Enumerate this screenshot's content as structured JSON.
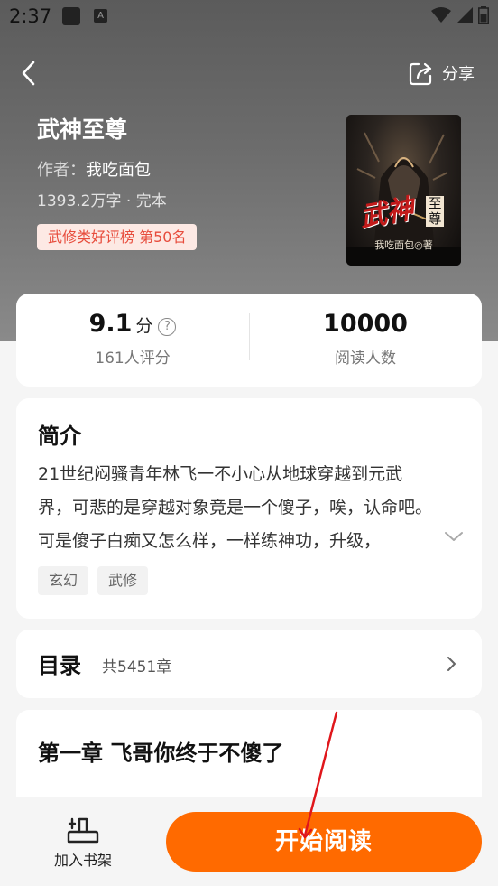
{
  "status_bar": {
    "time": "2:37"
  },
  "header": {
    "share_label": "分享"
  },
  "book": {
    "title": "武神至尊",
    "author_label": "作者：",
    "author": "我吃面包",
    "meta": "1393.2万字 · 完本",
    "rank_badge": "武修类好评榜  第50名",
    "cover_title": "武神",
    "cover_subtitle": "至尊",
    "cover_author": "我吃面包◎著"
  },
  "stats": {
    "score": "9.1",
    "score_unit": "分",
    "help": "?",
    "raters": "161人评分",
    "readers": "10000",
    "readers_label": "阅读人数"
  },
  "intro": {
    "title": "简介",
    "text": "21世纪闷骚青年林飞一不小心从地球穿越到元武界，可悲的是穿越对象竟是一个傻子，唉，认命吧。可是傻子白痴又怎么样，一样练神功，升级，",
    "tags": [
      "玄幻",
      "武修"
    ]
  },
  "toc": {
    "title": "目录",
    "count": "共5451章"
  },
  "chapter": {
    "title": "第一章 飞哥你终于不傻了"
  },
  "bottom": {
    "shelf_label": "加入书架",
    "read_label": "开始阅读"
  },
  "colors": {
    "accent": "#ff6a00",
    "rank_text": "#e74c3c",
    "rank_bg": "#fde9e4",
    "annotation": "#e0161b"
  }
}
